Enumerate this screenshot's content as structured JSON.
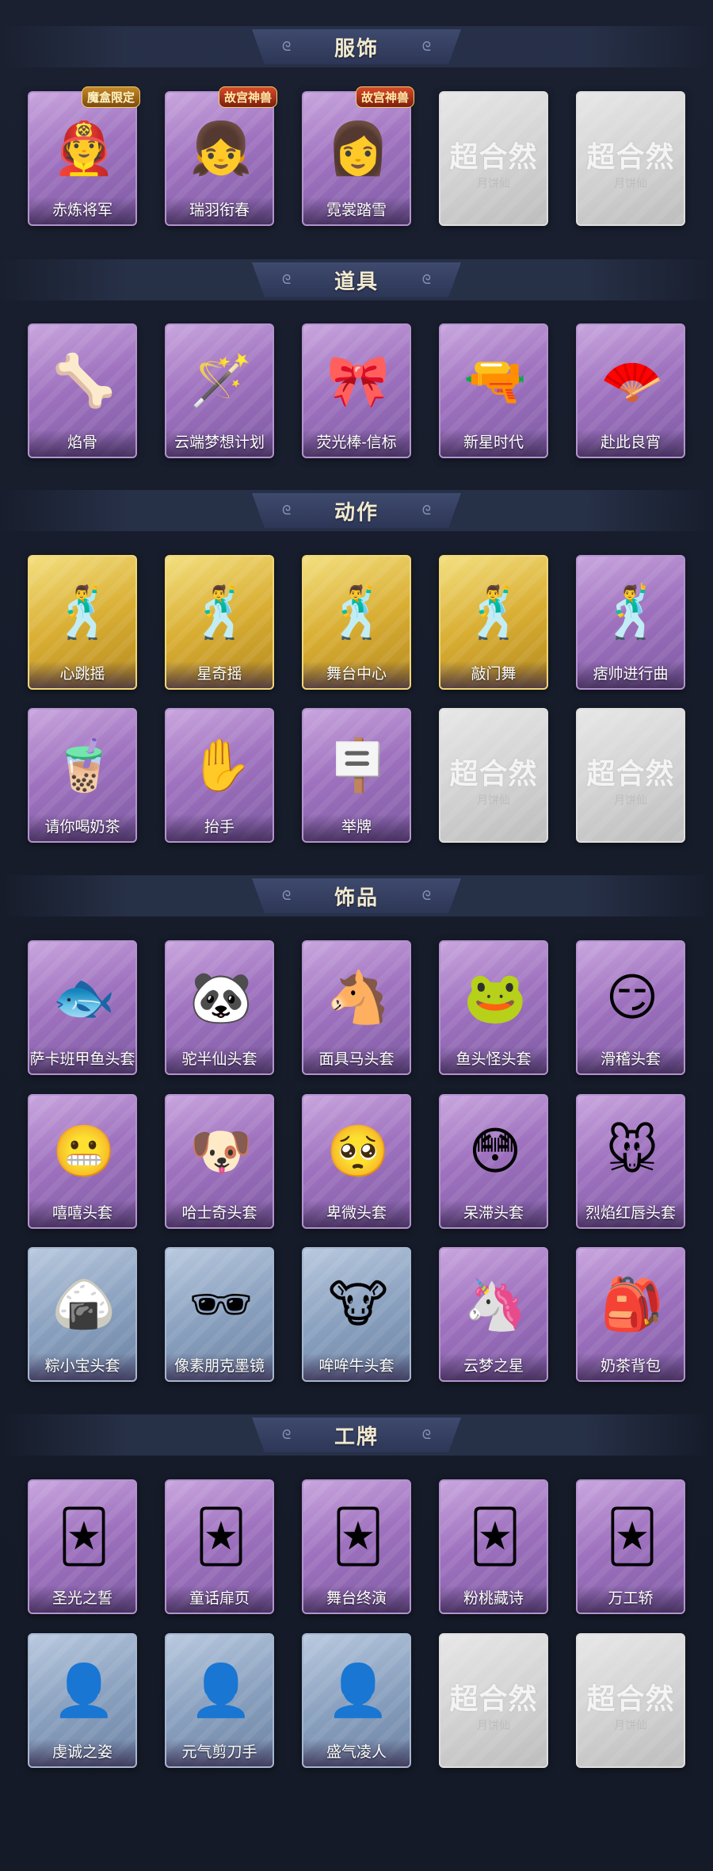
{
  "sections": [
    {
      "title": "服饰",
      "items": [
        {
          "label": "赤炼将军",
          "style": "purple",
          "icon": "general-character-icon",
          "tag": "魔盒限定"
        },
        {
          "label": "瑞羽衔春",
          "style": "purple",
          "icon": "feather-girl-icon",
          "tag": "故宫神兽"
        },
        {
          "label": "霓裳踏雪",
          "style": "purple",
          "icon": "snow-girl-icon",
          "tag": "故宫神兽"
        },
        {
          "label": "",
          "style": "gray",
          "icon": "placeholder-icon",
          "ph_big": "超合然",
          "ph_small": "月饼仙"
        },
        {
          "label": "",
          "style": "gray",
          "icon": "placeholder-icon",
          "ph_big": "超合然",
          "ph_small": "月饼仙"
        }
      ]
    },
    {
      "title": "道具",
      "items": [
        {
          "label": "焰骨",
          "style": "purple",
          "icon": "bone-staff-icon"
        },
        {
          "label": "云端梦想计划",
          "style": "purple",
          "icon": "magic-wand-icon"
        },
        {
          "label": "荧光棒-信标",
          "style": "purple",
          "icon": "glow-stick-icon"
        },
        {
          "label": "新星时代",
          "style": "purple",
          "icon": "revolver-icon"
        },
        {
          "label": "赴此良宵",
          "style": "purple",
          "icon": "fan-icon"
        }
      ]
    },
    {
      "title": "动作",
      "items": [
        {
          "label": "心跳摇",
          "style": "gold",
          "icon": "dance-pose-icon"
        },
        {
          "label": "星奇摇",
          "style": "gold",
          "icon": "dance-pose-icon"
        },
        {
          "label": "舞台中心",
          "style": "gold",
          "icon": "dance-pose-icon"
        },
        {
          "label": "敲门舞",
          "style": "gold",
          "icon": "dance-pose-icon"
        },
        {
          "label": "痞帅进行曲",
          "style": "purple",
          "icon": "dance-pose-icon"
        },
        {
          "label": "请你喝奶茶",
          "style": "purple",
          "icon": "milk-tea-pose-icon"
        },
        {
          "label": "抬手",
          "style": "purple",
          "icon": "raise-hand-icon"
        },
        {
          "label": "举牌",
          "style": "purple",
          "icon": "hold-sign-icon"
        },
        {
          "label": "",
          "style": "gray",
          "icon": "placeholder-icon",
          "ph_big": "超合然",
          "ph_small": "月饼仙"
        },
        {
          "label": "",
          "style": "gray",
          "icon": "placeholder-icon",
          "ph_big": "超合然",
          "ph_small": "月饼仙"
        }
      ]
    },
    {
      "title": "饰品",
      "items": [
        {
          "label": "萨卡班甲鱼头套",
          "style": "purple",
          "icon": "fish-head-icon"
        },
        {
          "label": "驼半仙头套",
          "style": "purple",
          "icon": "bear-head-icon"
        },
        {
          "label": "面具马头套",
          "style": "purple",
          "icon": "horse-head-icon"
        },
        {
          "label": "鱼头怪头套",
          "style": "purple",
          "icon": "fish-monster-icon"
        },
        {
          "label": "滑稽头套",
          "style": "purple",
          "icon": "funny-face-icon"
        },
        {
          "label": "嘻嘻头套",
          "style": "purple",
          "icon": "grin-face-icon"
        },
        {
          "label": "哈士奇头套",
          "style": "purple",
          "icon": "husky-head-icon"
        },
        {
          "label": "卑微头套",
          "style": "purple",
          "icon": "humble-face-icon"
        },
        {
          "label": "呆滞头套",
          "style": "purple",
          "icon": "dazed-face-icon"
        },
        {
          "label": "烈焰红唇头套",
          "style": "purple",
          "icon": "pikachu-head-icon"
        },
        {
          "label": "粽小宝头套",
          "style": "blue",
          "icon": "zongzi-head-icon"
        },
        {
          "label": "像素朋克墨镜",
          "style": "blue",
          "icon": "pixel-glasses-icon"
        },
        {
          "label": "哞哞牛头套",
          "style": "blue",
          "icon": "cow-head-icon"
        },
        {
          "label": "云梦之星",
          "style": "purple",
          "icon": "unicorn-icon"
        },
        {
          "label": "奶茶背包",
          "style": "purple",
          "icon": "milk-tea-bag-icon"
        }
      ]
    },
    {
      "title": "工牌",
      "items": [
        {
          "label": "圣光之誓",
          "style": "purple",
          "icon": "card-badge-icon"
        },
        {
          "label": "童话扉页",
          "style": "purple",
          "icon": "card-badge-icon"
        },
        {
          "label": "舞台终演",
          "style": "purple",
          "icon": "card-badge-icon"
        },
        {
          "label": "粉桃藏诗",
          "style": "purple",
          "icon": "card-badge-icon"
        },
        {
          "label": "万工轿",
          "style": "purple",
          "icon": "card-badge-icon"
        },
        {
          "label": "虔诚之姿",
          "style": "blue",
          "icon": "silhouette-card-icon"
        },
        {
          "label": "元气剪刀手",
          "style": "blue",
          "icon": "silhouette-card-icon"
        },
        {
          "label": "盛气凌人",
          "style": "blue",
          "icon": "silhouette-card-icon"
        },
        {
          "label": "",
          "style": "gray",
          "icon": "placeholder-icon",
          "ph_big": "超合然",
          "ph_small": "月饼仙"
        },
        {
          "label": "",
          "style": "gray",
          "icon": "placeholder-icon",
          "ph_big": "超合然",
          "ph_small": "月饼仙"
        }
      ]
    }
  ]
}
